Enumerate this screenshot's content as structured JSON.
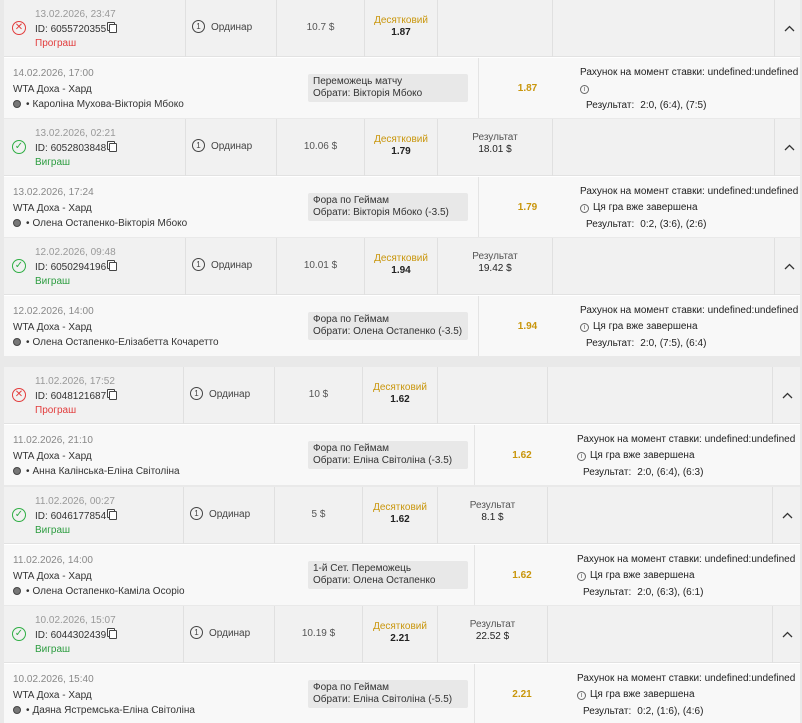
{
  "labels": {
    "id_prefix": "ID: ",
    "single": "Ординар",
    "decimal": "Десятковий",
    "result": "Результат",
    "account_at_bet": "Рахунок на момент ставки: undefined:undefined",
    "game_finished": "Ця гра вже завершена",
    "result_score": "Результат:",
    "pick_prefix": "Обрати: "
  },
  "colors": {
    "win": "#2fae44",
    "lose": "#e23c3c",
    "odds": "#c9960c"
  },
  "bets": [
    {
      "date": "13.02.2026, 23:47",
      "id": "6055720355",
      "status": "lose",
      "status_label": "Програш",
      "stake": "10.7 $",
      "odds": "1.87",
      "payout": "",
      "match_date": "14.02.2026, 17:00",
      "league": "WTA Доха - Хард",
      "match": "Кароліна Мухова-Вікторія Мбоко",
      "market": "Переможець матчу",
      "pick": "Вікторія Мбоко",
      "show_finished": false,
      "score": "2:0, (6:4), (7:5)"
    },
    {
      "date": "13.02.2026, 02:21",
      "id": "6052803848",
      "status": "win",
      "status_label": "Виграш",
      "stake": "10.06 $",
      "odds": "1.79",
      "payout": "18.01 $",
      "match_date": "13.02.2026, 17:24",
      "league": "WTA Доха - Хард",
      "match": "Олена Остапенко-Вікторія Мбоко",
      "market": "Фора по Геймам",
      "pick": "Вікторія Мбоко (-3.5)",
      "show_finished": true,
      "score": "0:2, (3:6), (2:6)"
    },
    {
      "date": "12.02.2026, 09:48",
      "id": "6050294196",
      "status": "win",
      "status_label": "Виграш",
      "stake": "10.01 $",
      "odds": "1.94",
      "payout": "19.42 $",
      "match_date": "12.02.2026, 14:00",
      "league": "WTA Доха - Хард",
      "match": "Олена Остапенко-Елізабетта Кочаретто",
      "market": "Фора по Геймам",
      "pick": "Олена Остапенко (-3.5)",
      "show_finished": true,
      "score": "2:0, (7:5), (6:4)"
    },
    {
      "date": "11.02.2026, 17:52",
      "id": "6048121687",
      "status": "lose",
      "status_label": "Програш",
      "stake": "10 $",
      "odds": "1.62",
      "payout": "",
      "match_date": "11.02.2026, 21:10",
      "league": "WTA Доха - Хард",
      "match": "Анна Калінська-Еліна Світоліна",
      "market": "Фора по Геймам",
      "pick": "Еліна Світоліна (-3.5)",
      "show_finished": true,
      "score": "2:0, (6:4), (6:3)"
    },
    {
      "date": "11.02.2026, 00:27",
      "id": "6046177854",
      "status": "win",
      "status_label": "Виграш",
      "stake": "5 $",
      "odds": "1.62",
      "payout": "8.1 $",
      "match_date": "11.02.2026, 14:00",
      "league": "WTA Доха - Хард",
      "match": "Олена Остапенко-Каміла Осоріо",
      "market": "1-й Сет. Переможець",
      "pick": "Олена Остапенко",
      "show_finished": true,
      "score": "2:0, (6:3), (6:1)"
    },
    {
      "date": "10.02.2026, 15:07",
      "id": "6044302439",
      "status": "win",
      "status_label": "Виграш",
      "stake": "10.19 $",
      "odds": "2.21",
      "payout": "22.52 $",
      "match_date": "10.02.2026, 15:40",
      "league": "WTA Доха - Хард",
      "match": "Даяна Ястремська-Еліна Світоліна",
      "market": "Фора по Геймам",
      "pick": "Еліна Світоліна (-5.5)",
      "show_finished": true,
      "score": "0:2, (1:6), (4:6)"
    }
  ]
}
